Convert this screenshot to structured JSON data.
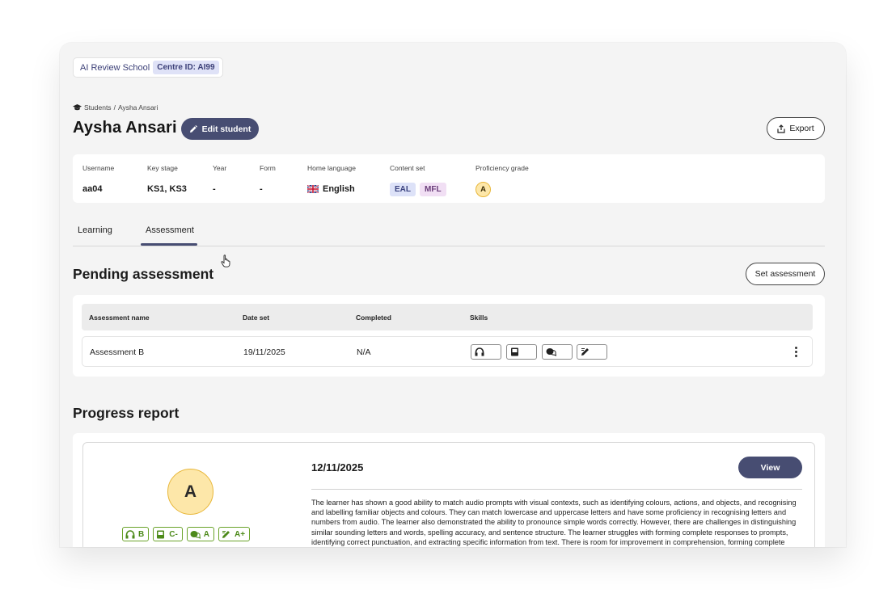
{
  "school": {
    "name": "AI Review School",
    "centre_id": "Centre ID: AI99"
  },
  "breadcrumb": {
    "root": "Students",
    "separator": "/",
    "current": "Aysha Ansari"
  },
  "student": {
    "name": "Aysha Ansari"
  },
  "actions": {
    "edit_label": "Edit student",
    "export_label": "Export"
  },
  "info": {
    "username": {
      "label": "Username",
      "value": "aa04"
    },
    "key_stage": {
      "label": "Key stage",
      "value": "KS1, KS3"
    },
    "year": {
      "label": "Year",
      "value": "-"
    },
    "form": {
      "label": "Form",
      "value": "-"
    },
    "home_language": {
      "label": "Home language",
      "value": "English",
      "flag_icon": "uk-flag-icon"
    },
    "content_set": {
      "label": "Content set",
      "chips": [
        "EAL",
        "MFL"
      ]
    },
    "proficiency": {
      "label": "Proficiency grade",
      "value": "A"
    }
  },
  "tabs": [
    {
      "label": "Learning",
      "active": false
    },
    {
      "label": "Assessment",
      "active": true
    }
  ],
  "pending": {
    "title": "Pending assessment",
    "set_label": "Set assessment",
    "columns": [
      "Assessment name",
      "Date set",
      "Completed",
      "Skills"
    ],
    "rows": [
      {
        "name": "Assessment B",
        "date_set": "19/11/2025",
        "completed": "N/A",
        "skills": [
          "listening-icon",
          "reading-icon",
          "speaking-icon",
          "writing-icon"
        ]
      }
    ]
  },
  "progress": {
    "title": "Progress report",
    "overall_grade": "A",
    "skill_grades": [
      {
        "icon": "listening-icon",
        "grade": "B"
      },
      {
        "icon": "reading-icon",
        "grade": "C-"
      },
      {
        "icon": "speaking-icon",
        "grade": "A"
      },
      {
        "icon": "writing-icon",
        "grade": "A+"
      }
    ],
    "date": "12/11/2025",
    "view_label": "View",
    "summary": "The learner has shown a good ability to match audio prompts with visual contexts, such as identifying colours, actions, and objects, and recognising and labelling familiar objects and colours. They can match lowercase and uppercase letters and have some proficiency in recognising letters and numbers from audio. The learner also demonstrated the ability to pronounce simple words correctly. However, there are challenges in distinguishing similar sounding letters and words, spelling accuracy, and sentence structure. The learner struggles with forming complete responses to prompts, identifying correct punctuation, and extracting specific information from text. There is room for improvement in comprehension, forming complete sentences, and"
  },
  "colors": {
    "accent": "#474d72",
    "grade_fill": "#fde7a9",
    "grade_border": "#e8b73a",
    "skill_green": "#6aa32a"
  }
}
